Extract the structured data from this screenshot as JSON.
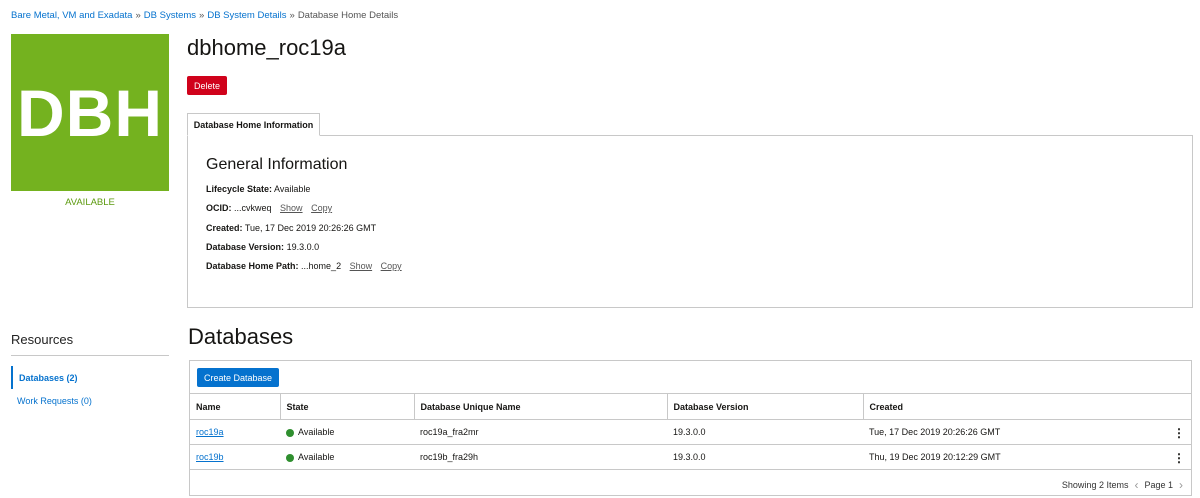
{
  "breadcrumb": {
    "items": [
      "Bare Metal, VM and Exadata",
      "DB Systems",
      "DB System Details"
    ],
    "current": "Database Home Details",
    "separator": "»"
  },
  "tile": {
    "text": "DBH",
    "status": "AVAILABLE",
    "color": "#74b21f"
  },
  "title": "dbhome_roc19a",
  "delete_label": "Delete",
  "tab_label": "Database Home Information",
  "general": {
    "heading": "General Information",
    "lifecycle_label": "Lifecycle State:",
    "lifecycle_value": "Available",
    "ocid_label": "OCID:",
    "ocid_value": "...cvkweq",
    "created_label": "Created:",
    "created_value": "Tue, 17 Dec 2019 20:26:26 GMT",
    "version_label": "Database Version:",
    "version_value": "19.3.0.0",
    "path_label": "Database Home Path:",
    "path_value": "...home_2",
    "show_label": "Show",
    "copy_label": "Copy"
  },
  "resources": {
    "title": "Resources",
    "items": [
      "Databases (2)",
      "Work Requests (0)"
    ]
  },
  "databases": {
    "heading": "Databases",
    "create_label": "Create Database",
    "columns": [
      "Name",
      "State",
      "Database Unique Name",
      "Database Version",
      "Created"
    ],
    "rows": [
      {
        "name": "roc19a",
        "state": "Available",
        "unique": "roc19a_fra2mr",
        "version": "19.3.0.0",
        "created": "Tue, 17 Dec 2019 20:26:26 GMT"
      },
      {
        "name": "roc19b",
        "state": "Available",
        "unique": "roc19b_fra29h",
        "version": "19.3.0.0",
        "created": "Thu, 19 Dec 2019 20:12:29 GMT"
      }
    ],
    "showing": "Showing 2 Items",
    "page": "Page 1"
  },
  "colors": {
    "link": "#0572ce",
    "danger": "#d0021b",
    "available": "#2f8f2f"
  }
}
